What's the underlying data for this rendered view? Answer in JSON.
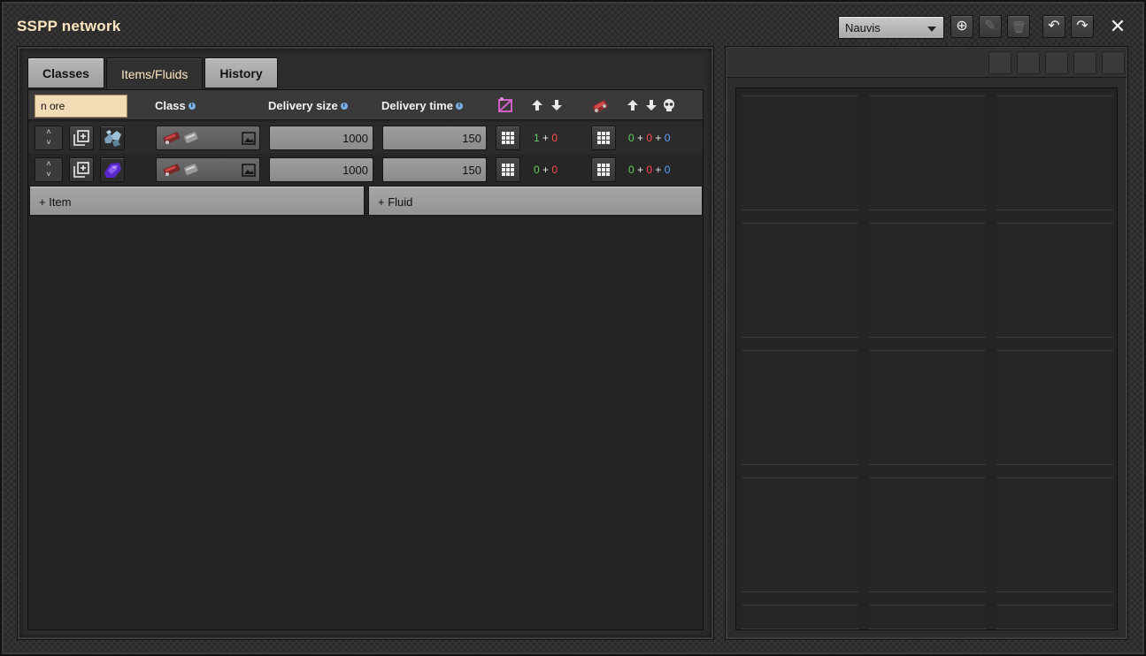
{
  "window": {
    "title": "SSPP network"
  },
  "surface_select": {
    "value": "Nauvis"
  },
  "title_buttons": [
    {
      "name": "add-surface-icon",
      "glyph": "⊕"
    },
    {
      "name": "edit-icon",
      "glyph": "✎"
    },
    {
      "name": "trash-icon",
      "glyph": "🗑"
    },
    {
      "name": "import-icon",
      "glyph": "↶"
    },
    {
      "name": "export-icon",
      "glyph": "↷"
    }
  ],
  "close_glyph": "✕",
  "tabs": [
    {
      "label": "Classes"
    },
    {
      "label": "Items/Fluids"
    },
    {
      "label": "History"
    }
  ],
  "active_tab": "Items/Fluids",
  "filter": {
    "value": "n ore"
  },
  "columns": {
    "class": "Class",
    "delivery_size": "Delivery size",
    "delivery_time": "Delivery time"
  },
  "rows": [
    {
      "item_icon": "iron-ore-icon",
      "delivery_size": "1000",
      "delivery_time": "150",
      "provider": {
        "a": "1",
        "b": "0"
      },
      "requester": {
        "a": "0",
        "b": "0",
        "c": "0"
      }
    },
    {
      "item_icon": "uranium-ore-icon",
      "delivery_size": "1000",
      "delivery_time": "150",
      "provider": {
        "a": "0",
        "b": "0"
      },
      "requester": {
        "a": "0",
        "b": "0",
        "c": "0"
      }
    }
  ],
  "plus": "+",
  "add_item": "+ Item",
  "add_fluid": "+ Fluid",
  "colors": {
    "title": "#ffe6c0",
    "green": "#5ed05e",
    "red": "#ff4a4a",
    "blue": "#5aa0ff",
    "filter_bg": "#f2dcb6"
  }
}
